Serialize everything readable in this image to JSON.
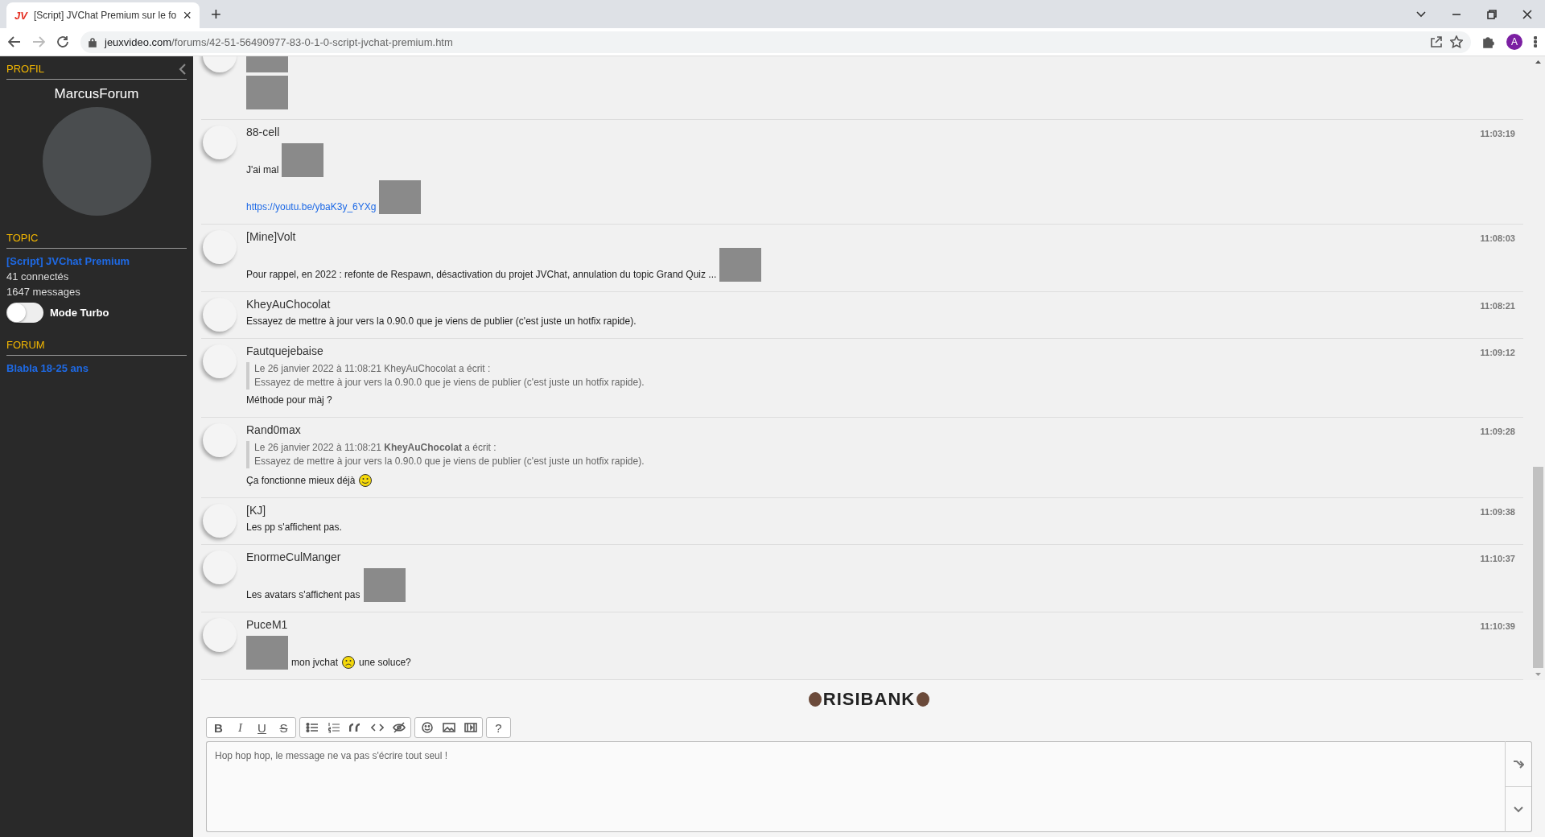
{
  "browser": {
    "tab": {
      "favicon": "JV",
      "title": "[Script] JVChat Premium sur le fo",
      "close": "×"
    },
    "new_tab": "+",
    "url_domain": "jeuxvideo.com",
    "url_path": "/forums/42-51-56490977-83-0-1-0-script-jvchat-premium.htm",
    "profile_initial": "A"
  },
  "sidebar": {
    "profil_title": "PROFIL",
    "username": "MarcusForum",
    "topic_title": "TOPIC",
    "topic_link": "[Script] JVChat Premium",
    "connected": "41 connectés",
    "messages": "1647 messages",
    "turbo": {
      "label": "Mode Turbo",
      "on": false
    },
    "forum_title": "FORUM",
    "forum_link": "Blabla 18-25 ans"
  },
  "messages": [
    {
      "lines": [
        [
          {
            "kind": "image"
          }
        ],
        [
          {
            "kind": "image"
          }
        ]
      ]
    },
    {
      "author": "88-cell",
      "time": "11:03:19",
      "lines": [
        [
          {
            "kind": "text",
            "text": "J'ai mal"
          },
          {
            "kind": "image"
          }
        ],
        [
          {
            "kind": "link",
            "text": "https://youtu.be/ybaK3y_6YXg"
          },
          {
            "kind": "image"
          }
        ]
      ]
    },
    {
      "author": "[Mine]Volt",
      "time": "11:08:03",
      "lines": [
        [
          {
            "kind": "text",
            "text": "Pour rappel, en 2022 : refonte de Respawn, désactivation du projet JVChat, annulation du topic Grand Quiz ..."
          },
          {
            "kind": "image"
          }
        ]
      ]
    },
    {
      "author": "KheyAuChocolat",
      "time": "11:08:21",
      "lines": [
        [
          {
            "kind": "text",
            "text": "Essayez de mettre à jour vers la 0.90.0 que je viens de publier (c'est juste un hotfix rapide)."
          }
        ]
      ]
    },
    {
      "author": "Fautquejebaise",
      "time": "11:09:12",
      "quote": {
        "header": "Le 26 janvier 2022 à 11:08:21 KheyAuChocolat a écrit :",
        "body": "Essayez de mettre à jour vers la 0.90.0 que je viens de publier (c'est juste un hotfix rapide)."
      },
      "lines": [
        [
          {
            "kind": "text",
            "text": "Méthode pour màj ?"
          }
        ]
      ]
    },
    {
      "author": "Rand0max",
      "time": "11:09:28",
      "quote": {
        "header": "Le 26 janvier 2022 à 11:08:21 **KheyAuChocolat** a écrit :",
        "body": "Essayez de mettre à jour vers la 0.90.0 que je viens de publier (c'est juste un hotfix rapide)."
      },
      "lines": [
        [
          {
            "kind": "text",
            "text": "Ça fonctionne mieux déjà"
          },
          {
            "kind": "smiley-happy"
          }
        ]
      ]
    },
    {
      "author": "[KJ]",
      "time": "11:09:38",
      "lines": [
        [
          {
            "kind": "text",
            "text": "Les pp s'affichent pas."
          }
        ]
      ]
    },
    {
      "author": "EnormeCulManger",
      "time": "11:10:37",
      "lines": [
        [
          {
            "kind": "text",
            "text": "Les avatars s'affichent pas"
          },
          {
            "kind": "image"
          }
        ]
      ]
    },
    {
      "author": "PuceM1",
      "time": "11:10:39",
      "lines": [
        [
          {
            "kind": "image"
          },
          {
            "kind": "text",
            "text": "mon jvchat"
          },
          {
            "kind": "smiley-sad"
          },
          {
            "kind": "text",
            "text": "une soluce?"
          }
        ]
      ]
    }
  ],
  "editor": {
    "logo": "RISIBANK",
    "toolbar": [
      [
        {
          "kind": "bold",
          "label": "B"
        },
        {
          "kind": "italic",
          "label": "I"
        },
        {
          "kind": "underline",
          "label": "U"
        },
        {
          "kind": "strike",
          "label": "S"
        }
      ],
      [
        {
          "kind": "bullet-list"
        },
        {
          "kind": "numbered-list"
        },
        {
          "kind": "quote"
        },
        {
          "kind": "code"
        },
        {
          "kind": "hide"
        }
      ],
      [
        {
          "kind": "smiley"
        },
        {
          "kind": "image"
        },
        {
          "kind": "video"
        }
      ],
      [
        {
          "kind": "help",
          "label": "?"
        }
      ]
    ],
    "placeholder": "Hop hop hop, le message ne va pas s'écrire tout seul !"
  }
}
